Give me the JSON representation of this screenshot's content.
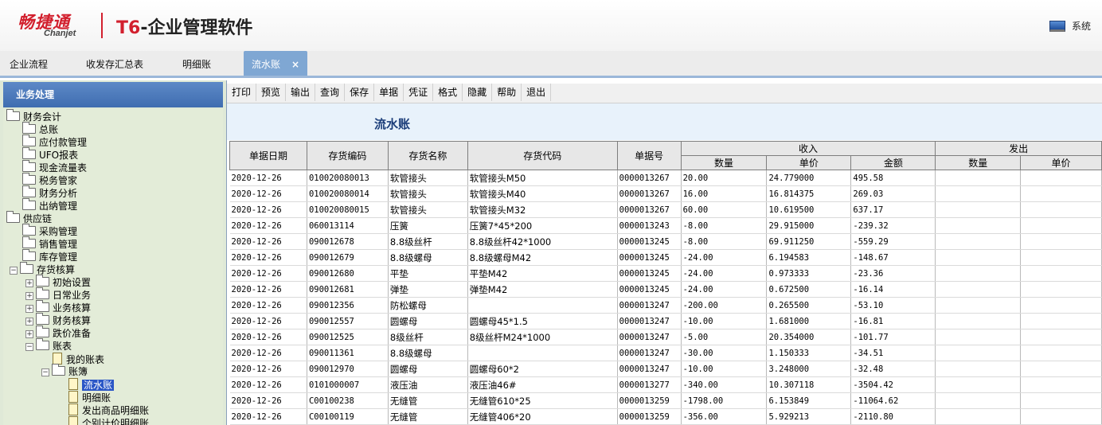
{
  "header": {
    "brand_cn": "畅捷通",
    "brand_en": "Chanjet",
    "product_t6": "T6",
    "product_name": "-企业管理软件",
    "system_label": "系统"
  },
  "tabs": [
    {
      "label": "企业流程"
    },
    {
      "label": "收发存汇总表"
    },
    {
      "label": "明细账"
    },
    {
      "label": "流水账",
      "close": "×",
      "active": true
    }
  ],
  "left": {
    "title": "业务处理",
    "tree": [
      {
        "label": "财务会计"
      },
      {
        "label": "总账"
      },
      {
        "label": "应付款管理"
      },
      {
        "label": "UFO报表"
      },
      {
        "label": "现金流量表"
      },
      {
        "label": "税务管家"
      },
      {
        "label": "财务分析"
      },
      {
        "label": "出纳管理"
      },
      {
        "label": "供应链"
      },
      {
        "label": "采购管理"
      },
      {
        "label": "销售管理"
      },
      {
        "label": "库存管理"
      },
      {
        "label": "存货核算"
      },
      {
        "label": "初始设置"
      },
      {
        "label": "日常业务"
      },
      {
        "label": "业务核算"
      },
      {
        "label": "财务核算"
      },
      {
        "label": "跌价准备"
      },
      {
        "label": "账表"
      },
      {
        "label": "我的账表"
      },
      {
        "label": "账簿"
      },
      {
        "label": "流水账"
      },
      {
        "label": "明细账"
      },
      {
        "label": "发出商品明细账"
      },
      {
        "label": "个别计价明细账"
      }
    ]
  },
  "toolbar": [
    "打印",
    "预览",
    "输出",
    "查询",
    "保存",
    "单据",
    "凭证",
    "格式",
    "隐藏",
    "帮助",
    "退出"
  ],
  "report": {
    "title": "流水账",
    "columns": [
      "单据日期",
      "存货编码",
      "存货名称",
      "存货代码",
      "单据号"
    ],
    "group_in": "收入",
    "group_out": "发出",
    "in_sub": [
      "数量",
      "单价",
      "金额"
    ],
    "out_sub": [
      "数量",
      "单价"
    ],
    "rows": [
      [
        "2020-12-26",
        "010020080013",
        "软管接头",
        "软管接头M50",
        "0000013267",
        "20.00",
        "24.779000",
        "495.58"
      ],
      [
        "2020-12-26",
        "010020080014",
        "软管接头",
        "软管接头M40",
        "0000013267",
        "16.00",
        "16.814375",
        "269.03"
      ],
      [
        "2020-12-26",
        "010020080015",
        "软管接头",
        "软管接头M32",
        "0000013267",
        "60.00",
        "10.619500",
        "637.17"
      ],
      [
        "2020-12-26",
        "060013114",
        "压簧",
        "压簧7*45*200",
        "0000013243",
        "-8.00",
        "29.915000",
        "-239.32"
      ],
      [
        "2020-12-26",
        "090012678",
        "8.8级丝杆",
        "8.8级丝杆42*1000",
        "0000013245",
        "-8.00",
        "69.911250",
        "-559.29"
      ],
      [
        "2020-12-26",
        "090012679",
        "8.8级螺母",
        "8.8级螺母M42",
        "0000013245",
        "-24.00",
        "6.194583",
        "-148.67"
      ],
      [
        "2020-12-26",
        "090012680",
        "平垫",
        "平垫M42",
        "0000013245",
        "-24.00",
        "0.973333",
        "-23.36"
      ],
      [
        "2020-12-26",
        "090012681",
        "弹垫",
        "弹垫M42",
        "0000013245",
        "-24.00",
        "0.672500",
        "-16.14"
      ],
      [
        "2020-12-26",
        "090012356",
        "防松螺母",
        "",
        "0000013247",
        "-200.00",
        "0.265500",
        "-53.10"
      ],
      [
        "2020-12-26",
        "090012557",
        "圆螺母",
        "圆螺母45*1.5",
        "0000013247",
        "-10.00",
        "1.681000",
        "-16.81"
      ],
      [
        "2020-12-26",
        "090012525",
        "8级丝杆",
        "8级丝杆M24*1000",
        "0000013247",
        "-5.00",
        "20.354000",
        "-101.77"
      ],
      [
        "2020-12-26",
        "090011361",
        "8.8级螺母",
        "",
        "0000013247",
        "-30.00",
        "1.150333",
        "-34.51"
      ],
      [
        "2020-12-26",
        "090012970",
        "圆螺母",
        "圆螺母60*2",
        "0000013247",
        "-10.00",
        "3.248000",
        "-32.48"
      ],
      [
        "2020-12-26",
        "0101000007",
        "液压油",
        "液压油46#",
        "0000013277",
        "-340.00",
        "10.307118",
        "-3504.42"
      ],
      [
        "2020-12-26",
        "C00100238",
        "无缝管",
        "无缝管610*25",
        "0000013259",
        "-1798.00",
        "6.153849",
        "-11064.62"
      ],
      [
        "2020-12-26",
        "C00100119",
        "无缝管",
        "无缝管406*20",
        "0000013259",
        "-356.00",
        "5.929213",
        "-2110.80"
      ]
    ]
  }
}
